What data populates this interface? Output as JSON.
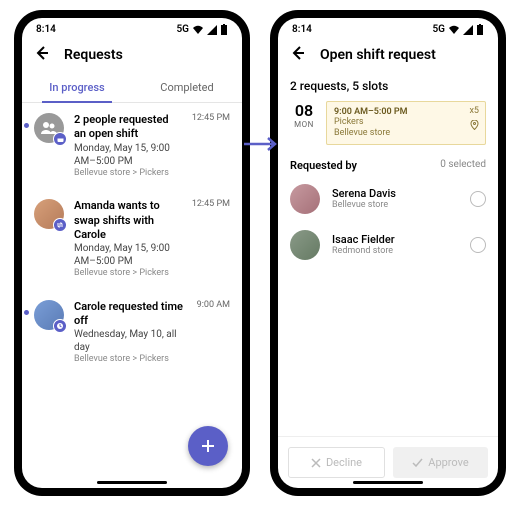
{
  "statusbar": {
    "time": "8:14",
    "network": "5G"
  },
  "left": {
    "title": "Requests",
    "tabs": {
      "in_progress": "In progress",
      "completed": "Completed"
    },
    "items": [
      {
        "title": "2 people requested an open shift",
        "sub": "Monday, May 15, 9:00 AM–5:00 PM",
        "meta": "Bellevue store > Pickers",
        "time": "12:45 PM"
      },
      {
        "title": "Amanda wants to swap shifts with Carole",
        "sub": "Monday, May 15, 9:00 AM–5:00 PM",
        "meta": "Bellevue store > Pickers",
        "time": "12:45 PM"
      },
      {
        "title": "Carole requested time off",
        "sub": "Wednesday, May 10, all day",
        "meta": "Bellevue store > Pickers",
        "time": "9:00 AM"
      }
    ]
  },
  "right": {
    "title": "Open shift request",
    "summary": "2 requests, 5 slots",
    "date_num": "08",
    "date_day": "MON",
    "shift": {
      "time": "9:00 AM–5:00 PM",
      "role": "Pickers",
      "store": "Bellevue store",
      "count": "x5"
    },
    "section": {
      "label": "Requested by",
      "selected": "0 selected"
    },
    "requesters": [
      {
        "name": "Serena Davis",
        "store": "Bellevue store"
      },
      {
        "name": "Isaac Fielder",
        "store": "Redmond store"
      }
    ],
    "buttons": {
      "decline": "Decline",
      "approve": "Approve"
    }
  }
}
